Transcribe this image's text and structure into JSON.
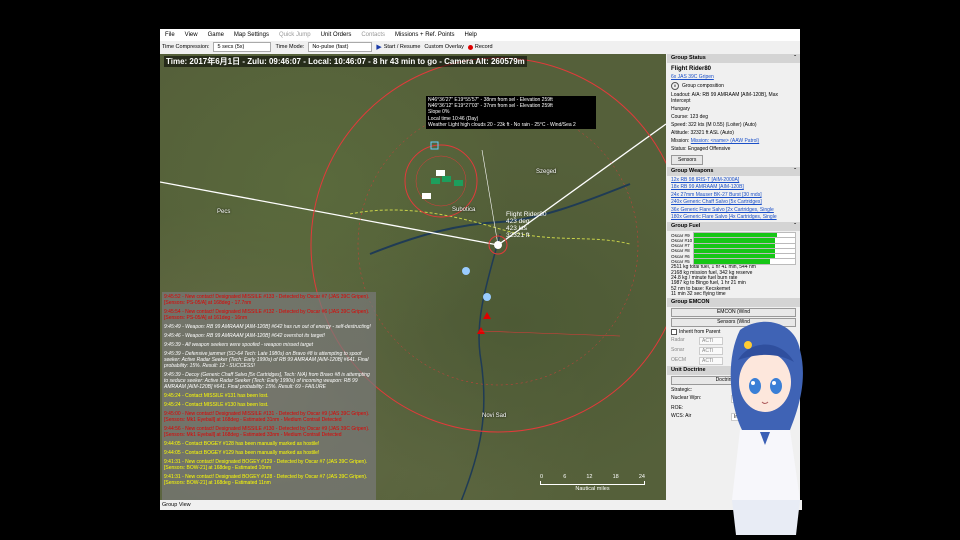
{
  "menu": [
    "File",
    "View",
    "Game",
    "Map Settings",
    "Quick Jump",
    "Unit Orders",
    "Contacts",
    "Missions + Ref. Points",
    "Help"
  ],
  "menu_disabled": [
    "Quick Jump",
    "Contacts"
  ],
  "toolbar": {
    "compression_label": "Time Compression:",
    "compression_value": "5 secs (5x)",
    "mode_label": "Time Mode:",
    "mode_value": "No-pulse (fast)",
    "start_label": "Start / Resume",
    "overlay_label": "Custom Overlay",
    "record_label": "Record"
  },
  "status_line": "Time: 2017年6月1日 - Zulu: 09:46:07 - Local: 10:46:07 - 8 hr 43 min to go -  Camera Alt: 260579m",
  "tooltip": [
    "N46°36'27\"  E19°55'57\" - 38nm from sel - Elevation 259ft",
    "N46°36'12\"  E19°27'03\" - 37nm from sel - Elevation 259ft",
    "Slope 0%",
    "Local time 10:46 (Day)",
    "Weather Light high clouds 20 - 23k ft - No rain - 25°C - Wind/Sea 2"
  ],
  "cities": {
    "szeged": "Szeged",
    "pecs": "Pecs",
    "subotica": "Subotica",
    "novi_sad": "Novi Sad"
  },
  "selected_unit": {
    "name": "Flight Rider80",
    "heading": "423 deg",
    "speed": "423 kts",
    "alt": "32321 ft"
  },
  "log": [
    {
      "c": "red",
      "t": "9:45:52 - New contact! Designated MISSILE #133 - Detected by Oscar #7 (JAS 39C Gripen). [Sensors: PS-05/A] at 168deg - 17.7nm"
    },
    {
      "c": "red",
      "t": "9:45:54 - New contact! Designated MISSILE #132 - Detected by Oscar #6 (JAS 39C Gripen). [Sensors: PS-05/A] at 161deg - 16nm"
    },
    {
      "c": "white",
      "t": "9:45:49 - Weapon: RB 99 AMRAAM [AIM-120B] #642 has run out of energy - self-destructing!"
    },
    {
      "c": "white",
      "t": "9:45:46 - Weapon: RB 99 AMRAAM [AIM-120B] #642 overshot its target!"
    },
    {
      "c": "white",
      "t": "9:45:39 - All weapon seekers were spoofed - weapon missed target"
    },
    {
      "c": "white",
      "t": "9:45:39 - Defensive jammer (SO-64 Tech: Late 1980s) on Bravo #8 is attempting to spoof seeker: Active Radar Seeker (Tech: Early 1990s) of RB 99 AMRAAM [AIM-120B] #641. Final probability: 15%. Result: 12 - SUCCESS!"
    },
    {
      "c": "white",
      "t": "9:45:39 - Decoy (Generic Chaff Salvo [5x Cartridges], Tech: N/A) from Bravo #8 is attempting to seduce seeker: Active Radar Seeker (Tech: Early 1990s) of incoming weapon: RB 99 AMRAAM [AIM-120B] #641. Final probability: 15%. Result: 69 - FAILURE"
    },
    {
      "c": "yellow",
      "t": "9:45:24 - Contact MISSILE #131 has been lost."
    },
    {
      "c": "yellow",
      "t": "9:45:24 - Contact MISSILE #130 has been lost."
    },
    {
      "c": "red",
      "t": "9:45:00 - New contact! Designated MISSILE #131 - Detected by Oscar #9 (JAS 39C Gripen). [Sensors: Mk1 Eyeball] at 168deg - Estimated 31nm - Medium Contrail Detected"
    },
    {
      "c": "red",
      "t": "9:44:56 - New contact! Designated MISSILE #130 - Detected by Oscar #9 (JAS 39C Gripen). [Sensors: Mk1 Eyeball] at 168deg - Estimated 33nm - Medium Contrail Detected"
    },
    {
      "c": "yellow",
      "t": "9:44:05 - Contact BOGEY #128 has been manually marked as hostile!"
    },
    {
      "c": "yellow",
      "t": "9:44:05 - Contact BOGEY #129 has been manually marked as hostile!"
    },
    {
      "c": "yellow",
      "t": "9:41:31 - New contact! Designated BOGEY #129 - Detected by Oscar #7 (JAS 39C Gripen). [Sensors: BOW-21] at 168deg - Estimated 10nm"
    },
    {
      "c": "yellow",
      "t": "9:41:31 - New contact! Designated BOGEY #128 - Detected by Oscar #7 (JAS 39C Gripen). [Sensors: BOW-21] at 168deg - Estimated 11nm"
    }
  ],
  "scale": {
    "ticks": [
      "0",
      "6",
      "12",
      "18",
      "24"
    ],
    "unit": "Nautical miles"
  },
  "footer": "Group View",
  "panel": {
    "status_header": "Group Status",
    "group_name": "Flight Rider80",
    "aircraft": "6x JAS 39C Gripen",
    "composition_label": "Group composition",
    "loadout": "Loadout: A/A: RB 99 AMRAAM [AIM-120B], Max Intercept",
    "country": "Hungary",
    "course": "Course: 123 deg",
    "speed": "Speed: 322 kts (M 0.55) (Loiter)   (Auto)",
    "altitude": "Altitude: 32321 ft ASL   (Auto)",
    "mission_label": "Mission:",
    "mission_value": "Mission: <name> (AAW Patrol)",
    "status": "Status: Engaged Offensive",
    "sensors_btn": "Sensors",
    "weapons_header": "Group Weapons",
    "weapons": [
      "12x RB 98 IRIS-T [AIM-2000A]",
      "18x RB 99 AMRAAM [AIM-120B]",
      "24x 27mm Mauser BK-27 Burst [30 rnds]",
      "240x Generic Chaff Salvo [5x Cartridges]",
      "36x Generic Flare Salvo [2x Cartridges, Single",
      "180x Generic Flare Salvo [4x Cartridges, Single"
    ],
    "fuel_header": "Group Fuel",
    "fuel": [
      {
        "name": "Oscar #9",
        "level": 0.82
      },
      {
        "name": "Oscar #10",
        "level": 0.8
      },
      {
        "name": "Oscar #7",
        "level": 0.8
      },
      {
        "name": "Oscar #8",
        "level": 0.8
      },
      {
        "name": "Oscar #6",
        "level": 0.8
      },
      {
        "name": "Oscar #5",
        "level": 0.75
      }
    ],
    "fuel_info": [
      "2511 kg total fuel, 1 hr 41 min, 544 nm",
      "2168 kg mission fuel, 342 kg reserve",
      "24.8 kg / minute fuel burn rate",
      "1987 kg to Bingo fuel, 1 hr 21 min",
      "52 nm to base: Kecskemet",
      "11 min 32 sec flying time"
    ],
    "emcon_header": "Group EMCON",
    "emcon_btn": "EMCON (Wind",
    "sensors_btn2": "Sensors (Wind",
    "inherit_label": "Inherit from Parent",
    "emcon_rows": [
      {
        "k": "Radar",
        "v": "ACTI"
      },
      {
        "k": "Sonar",
        "v": "ACTI"
      },
      {
        "k": "OECM",
        "v": "ACTI"
      }
    ],
    "doctrine_header": "Unit Doctrine",
    "doctrine_btn": "Doctrine (Windo",
    "strategic": "Strategic:",
    "nuclear": "Nuclear Wpn:",
    "nuclear_val": "Inh",
    "roe": "ROE:",
    "wcs_air": "WCS: Air",
    "wcs_val": "Inh"
  },
  "colors": {
    "range_ring": "#e23a3a",
    "panel_link": "#1a4fc8",
    "fuel_green": "#16c616"
  }
}
